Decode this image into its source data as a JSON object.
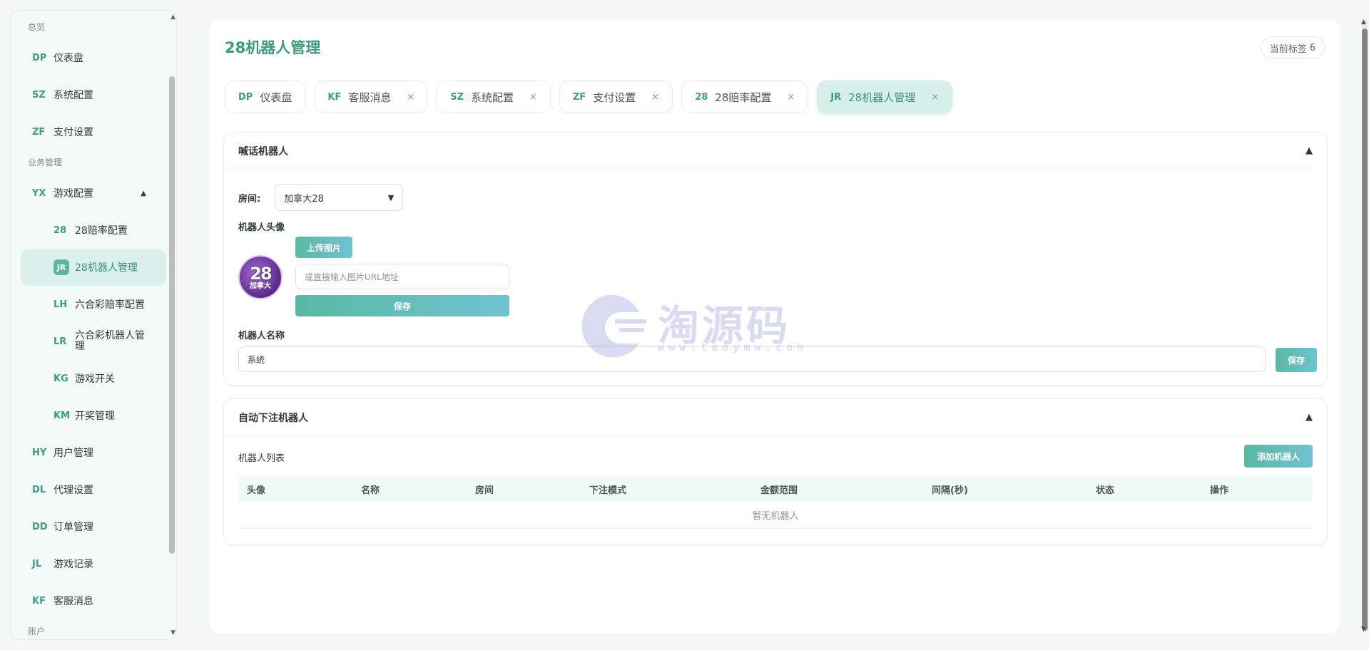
{
  "sidebar": {
    "sections": [
      "总览",
      "业务管理",
      "账户"
    ],
    "items": [
      {
        "code": "DP",
        "label": "仪表盘"
      },
      {
        "code": "SZ",
        "label": "系统配置"
      },
      {
        "code": "ZF",
        "label": "支付设置"
      },
      {
        "code": "YX",
        "label": "游戏配置"
      },
      {
        "code": "28",
        "label": "28赔率配置"
      },
      {
        "code": "JR",
        "label": "28机器人管理"
      },
      {
        "code": "LH",
        "label": "六合彩赔率配置"
      },
      {
        "code": "LR",
        "label": "六合彩机器人管理"
      },
      {
        "code": "KG",
        "label": "游戏开关"
      },
      {
        "code": "KM",
        "label": "开奖管理"
      },
      {
        "code": "HY",
        "label": "用户管理"
      },
      {
        "code": "DL",
        "label": "代理设置"
      },
      {
        "code": "DD",
        "label": "订单管理"
      },
      {
        "code": "JL",
        "label": "游戏记录"
      },
      {
        "code": "KF",
        "label": "客服消息"
      }
    ]
  },
  "header": {
    "title": "28机器人管理",
    "tag_count_label": "当前标签",
    "tag_count": "6"
  },
  "tabs": [
    {
      "code": "DP",
      "label": "仪表盘"
    },
    {
      "code": "KF",
      "label": "客服消息",
      "close": "×"
    },
    {
      "code": "SZ",
      "label": "系统配置",
      "close": "×"
    },
    {
      "code": "ZF",
      "label": "支付设置",
      "close": "×"
    },
    {
      "code": "28",
      "label": "28赔率配置",
      "close": "×"
    },
    {
      "code": "JR",
      "label": "28机器人管理",
      "close": "×"
    }
  ],
  "shout_robot": {
    "title": "喊话机器人",
    "room_label": "房间:",
    "room_value": "加拿大28",
    "avatar_label": "机器人头像",
    "upload_button": "上传图片",
    "url_placeholder": "或直接输入图片URL地址",
    "avatar_save_button": "保存",
    "avatar_text_big": "28",
    "avatar_text_small": "加拿大",
    "name_label": "机器人名称",
    "name_value": "系统",
    "name_save_button": "保存"
  },
  "auto_bet_robot": {
    "title": "自动下注机器人",
    "list_label": "机器人列表",
    "add_button": "添加机器人",
    "columns": [
      "头像",
      "名称",
      "房间",
      "下注模式",
      "金额范围",
      "间隔(秒)",
      "状态",
      "操作"
    ],
    "empty_text": "暂无机器人"
  },
  "watermark": {
    "text": "淘源码",
    "url": "www.taoymw.com"
  }
}
